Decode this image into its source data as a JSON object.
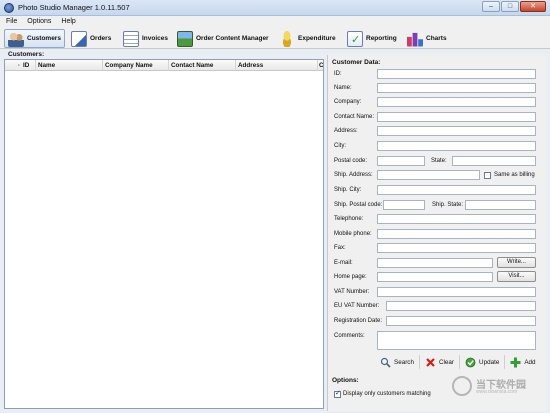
{
  "window": {
    "title": "Photo Studio Manager 1.0.11.507"
  },
  "menu": {
    "items": [
      "File",
      "Options",
      "Help"
    ]
  },
  "toolbar": {
    "customers": "Customers",
    "orders": "Orders",
    "invoices": "Invoices",
    "order_content_manager": "Order Content Manager",
    "expenditure": "Expenditure",
    "reporting": "Reporting",
    "charts": "Charts"
  },
  "customers_list": {
    "label": "Customers:",
    "columns": [
      "ID",
      "Name",
      "Company Name",
      "Contact Name",
      "Address",
      "C"
    ]
  },
  "customer_data": {
    "header": "Customer Data:",
    "fields": {
      "id": "ID:",
      "name": "Name:",
      "company": "Company:",
      "contact_name": "Contact Name:",
      "address": "Address:",
      "city": "City:",
      "postal_code": "Postal code:",
      "state": "State:",
      "ship_address": "Ship. Address:",
      "same_as_billing": "Same as billing",
      "ship_city": "Ship. City:",
      "ship_postal_code": "Ship. Postal code:",
      "ship_state": "Ship. State:",
      "telephone": "Telephone:",
      "mobile_phone": "Mobile phone:",
      "fax": "Fax:",
      "email": "E-mail:",
      "home_page": "Home page:",
      "vat_number": "VAT Number:",
      "eu_vat_number": "EU VAT Number:",
      "registration_date": "Registration Date:",
      "comments": "Comments:"
    },
    "values": {
      "id": "",
      "name": "",
      "company": "",
      "contact_name": "",
      "address": "",
      "city": "",
      "postal_code": "",
      "state": "",
      "ship_address": "",
      "ship_city": "",
      "ship_postal_code": "",
      "ship_state": "",
      "telephone": "",
      "mobile_phone": "",
      "fax": "",
      "email": "",
      "home_page": "",
      "vat_number": "",
      "eu_vat_number": "",
      "registration_date": "",
      "comments": ""
    },
    "write_button": "Write...",
    "visit_button": "Visit...",
    "actions": {
      "search": "Search",
      "clear": "Clear",
      "update": "Update",
      "add": "Add"
    }
  },
  "options": {
    "label": "Options:",
    "display_only_matching": "Display only customers matching",
    "display_only_matching_checked": true
  },
  "watermark": {
    "text": "当下软件园",
    "sub": "www.downxia.com"
  }
}
